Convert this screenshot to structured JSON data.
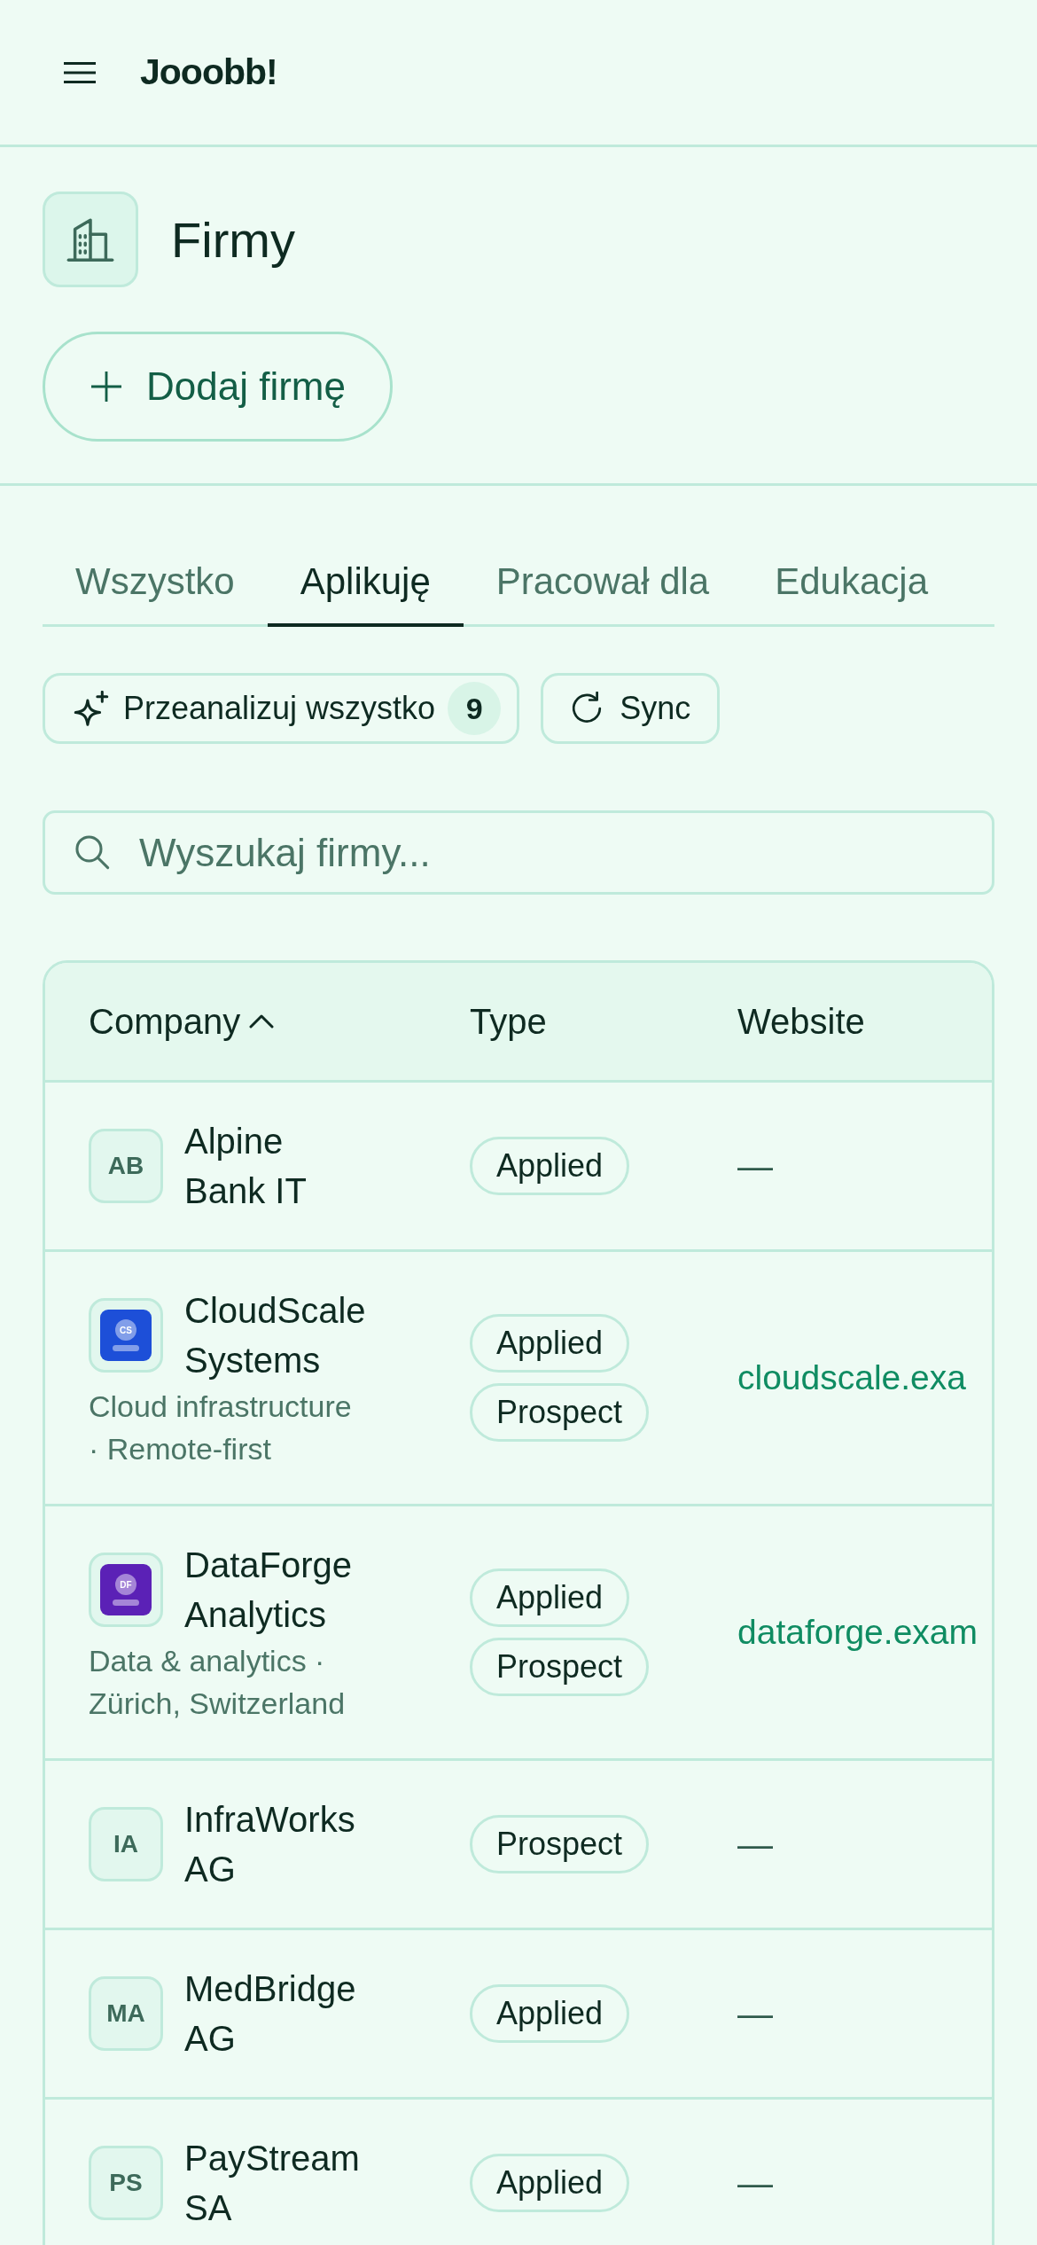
{
  "top_bar": {
    "app_name": "Jooobb!"
  },
  "page_header": {
    "title": "Firmy",
    "add_button": "Dodaj firmę"
  },
  "tabs": [
    {
      "label": "Wszystko",
      "selected": false
    },
    {
      "label": "Aplikuję",
      "selected": true
    },
    {
      "label": "Pracował dla",
      "selected": false
    },
    {
      "label": "Edukacja",
      "selected": false
    }
  ],
  "actions": [
    {
      "kind": "analyze",
      "label": "Przeanalizuj wszystko",
      "count": "9"
    },
    {
      "kind": "sync",
      "label": "Sync"
    }
  ],
  "search": {
    "placeholder": "Wyszukaj firmy..."
  },
  "table": {
    "columns": [
      {
        "label": "Company",
        "sorted": true
      },
      {
        "label": "Type",
        "sorted": false
      },
      {
        "label": "Website",
        "sorted": false
      }
    ],
    "rows": [
      {
        "kind": "initials",
        "initials": "AB",
        "name": "Alpine Bank IT",
        "types": [
          "Applied"
        ],
        "website": {
          "text": "—",
          "link": false
        }
      },
      {
        "kind": "logo",
        "logo_text": "CS",
        "color": "#1d4fd8",
        "name": "CloudScale Systems",
        "description": "Cloud infrastructure · Remote-first",
        "types": [
          "Applied",
          "Prospect"
        ],
        "website": {
          "text": "cloudscale.exa",
          "link": true
        }
      },
      {
        "kind": "logo",
        "logo_text": "DF",
        "color": "#5b21b6",
        "name": "DataForge Analytics",
        "description": "Data & analytics · Zürich, Switzerland",
        "types": [
          "Applied",
          "Prospect"
        ],
        "website": {
          "text": "dataforge.exam",
          "link": true
        }
      },
      {
        "kind": "initials",
        "initials": "IA",
        "name": "InfraWorks AG",
        "types": [
          "Prospect"
        ],
        "website": {
          "text": "—",
          "link": false
        }
      },
      {
        "kind": "initials",
        "initials": "MA",
        "name": "MedBridge AG",
        "types": [
          "Applied"
        ],
        "website": {
          "text": "—",
          "link": false
        }
      },
      {
        "kind": "initials",
        "initials": "PS",
        "name": "PayStream SA",
        "types": [
          "Applied"
        ],
        "website": {
          "text": "—",
          "link": false
        }
      }
    ]
  }
}
